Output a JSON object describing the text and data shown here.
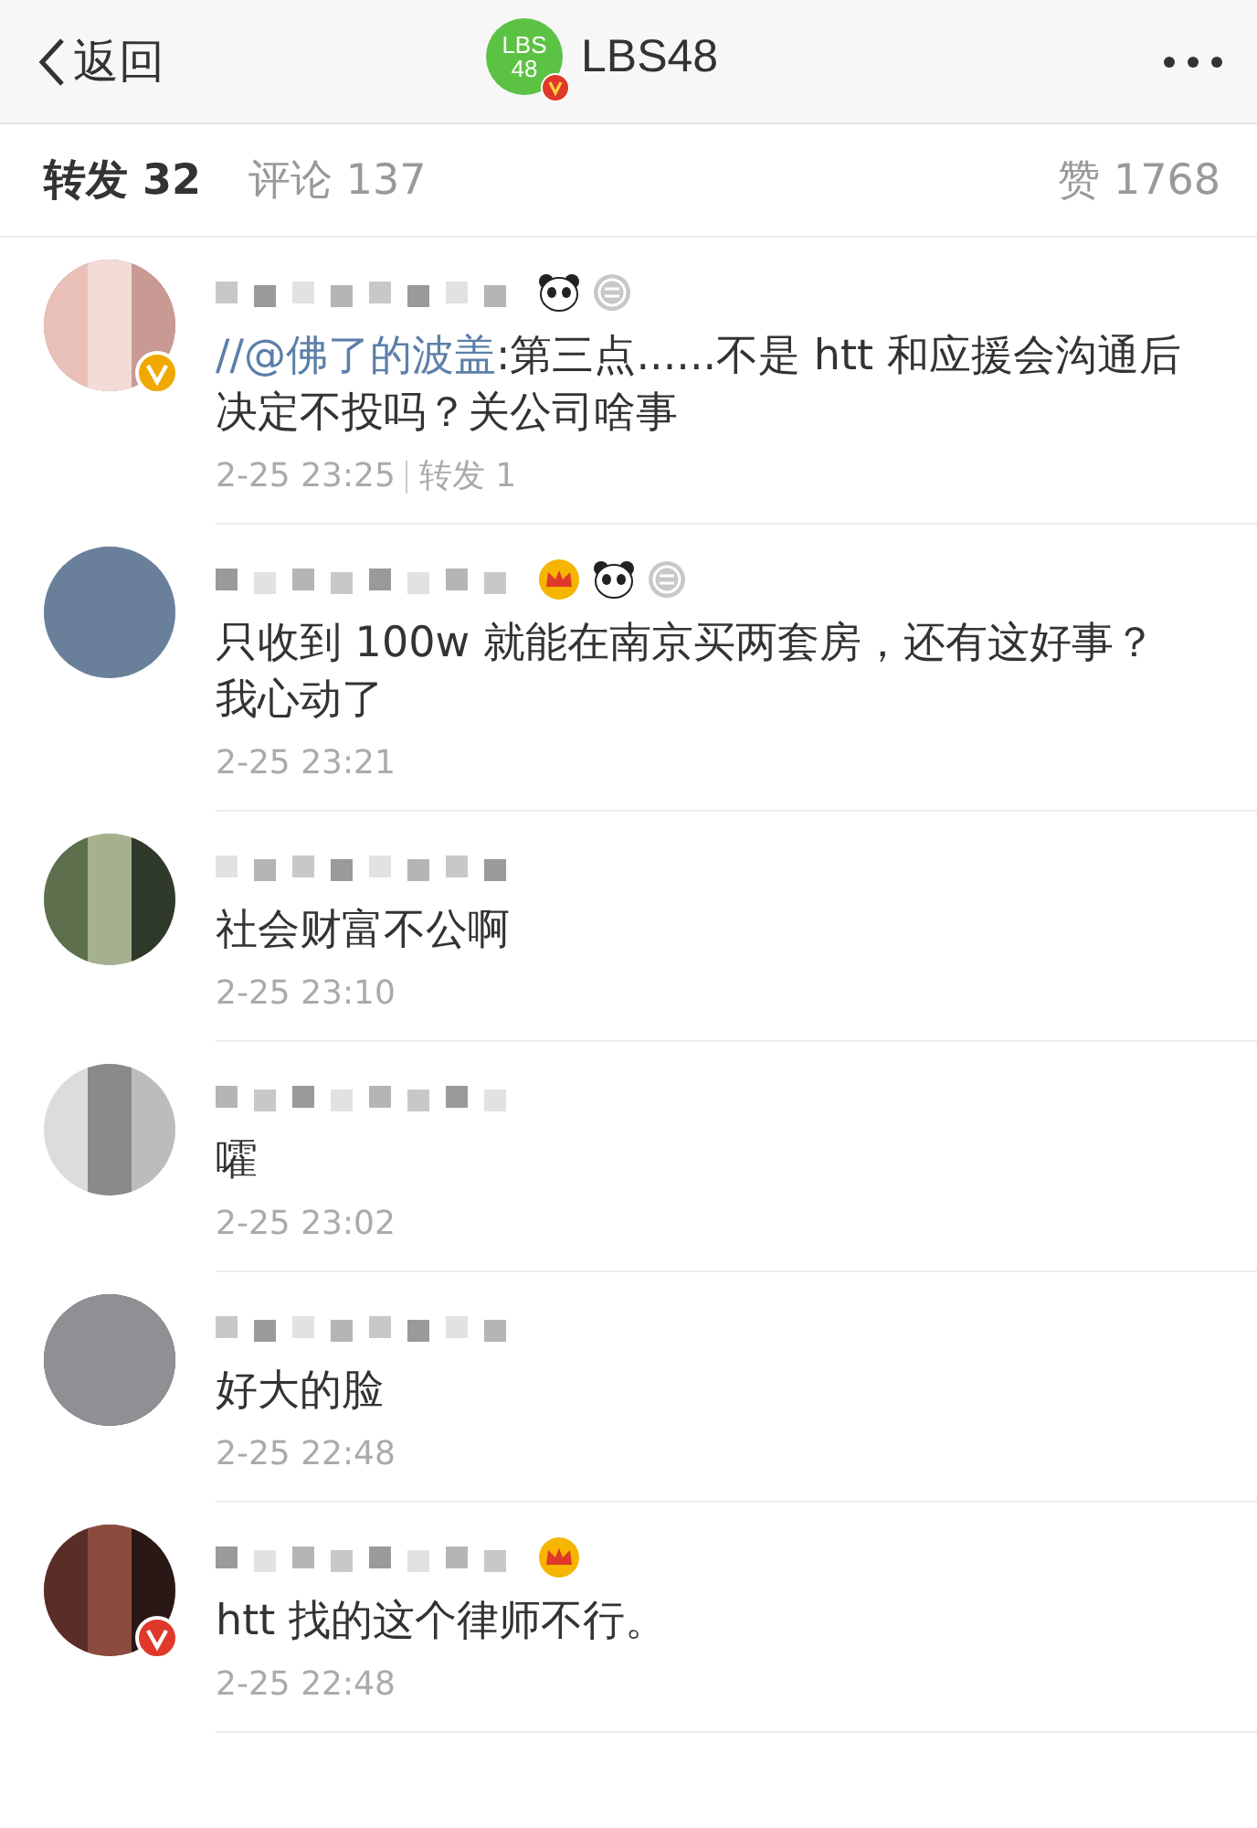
{
  "header": {
    "back": "返回",
    "logo_text": [
      "LBS",
      "48"
    ],
    "title": "LBS48"
  },
  "tabs": [
    {
      "label": "转发 32",
      "selected": true
    },
    {
      "label": "评论 137",
      "selected": false
    },
    {
      "label": "赞 1768",
      "selected": false
    }
  ],
  "comments": [
    {
      "badges": [
        {
          "kind": "panda"
        },
        {
          "kind": "medal"
        }
      ],
      "verified_badge": {
        "color": "#f0a800"
      },
      "mention": "//@佛了的波盖",
      "text": ":第三点......不是 htt 和应援会沟通后决定不投吗？关公司啥事",
      "time": "2-25 23:25",
      "reposts": "转发 1"
    },
    {
      "badges": [
        {
          "kind": "crown"
        },
        {
          "kind": "panda"
        },
        {
          "kind": "medal"
        }
      ],
      "text": "只收到 100w 就能在南京买两套房，还有这好事？我心动了",
      "time": "2-25 23:21"
    },
    {
      "text": "社会财富不公啊",
      "time": "2-25 23:10"
    },
    {
      "text": "嚯",
      "time": "2-25 23:02"
    },
    {
      "text": "好大的脸",
      "time": "2-25 22:48"
    },
    {
      "badges": [
        {
          "kind": "crown"
        }
      ],
      "verified_badge": {
        "color": "#e0382a"
      },
      "text": "htt  找的这个律师不行。",
      "time": "2-25 22:48"
    }
  ]
}
